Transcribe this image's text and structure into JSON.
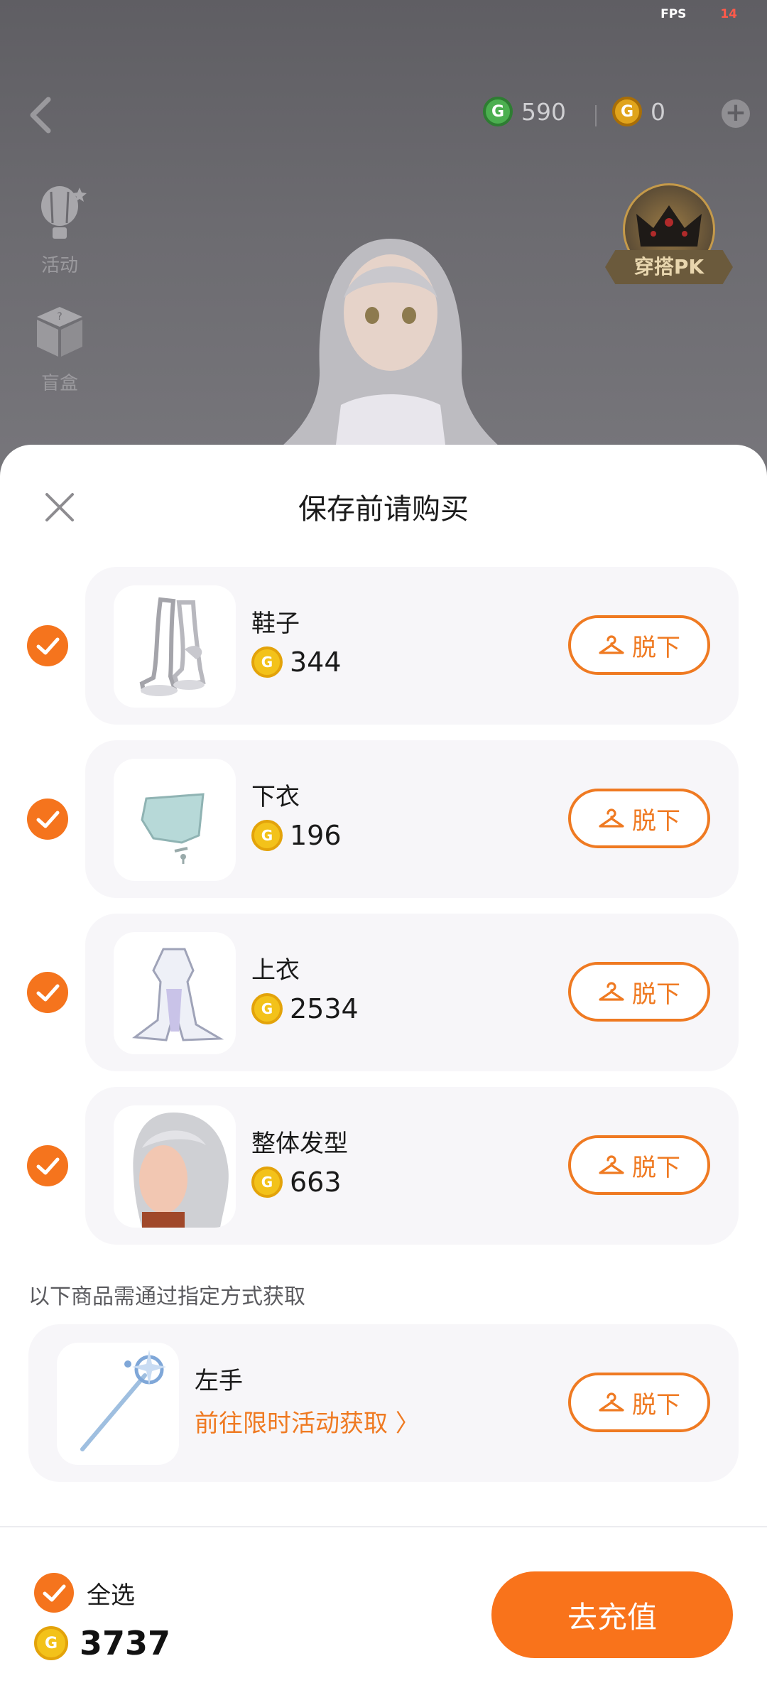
{
  "status": {
    "fps_label": "FPS",
    "fps_value": "14"
  },
  "top_bar": {
    "green_coin_amount": "590",
    "gold_coin_amount": "0"
  },
  "sidebar": {
    "items": [
      {
        "label": "活动"
      },
      {
        "label": "盲盒"
      }
    ]
  },
  "pk_badge": {
    "label": "穿搭PK"
  },
  "sheet": {
    "title": "保存前请购买",
    "take_off_label": "脱下",
    "items": [
      {
        "name": "鞋子",
        "price": "344"
      },
      {
        "name": "下衣",
        "price": "196"
      },
      {
        "name": "上衣",
        "price": "2534"
      },
      {
        "name": "整体发型",
        "price": "663"
      }
    ],
    "special_note": "以下商品需通过指定方式获取",
    "special_item": {
      "name": "左手",
      "link_text": "前往限时活动获取 〉"
    },
    "select_all_label": "全选",
    "total_price": "3737",
    "recharge_label": "去充值"
  },
  "colors": {
    "accent": "#f5741d",
    "card_bg": "#f7f6f9",
    "coin_gold": "#f3c21a"
  },
  "icons": [
    "back-arrow-icon",
    "green-coin-icon",
    "gold-coin-icon",
    "plus-icon",
    "balloon-icon",
    "blind-box-icon",
    "crown-icon",
    "close-icon",
    "check-icon",
    "hanger-icon"
  ]
}
